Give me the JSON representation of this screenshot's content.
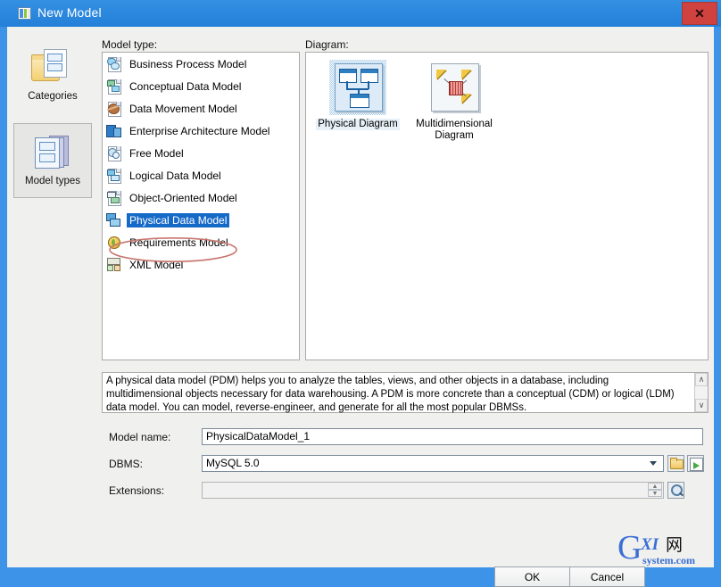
{
  "window": {
    "title": "New Model",
    "close_label": "✕",
    "title_icon": "document-icon"
  },
  "rail": {
    "items": [
      {
        "label": "Categories",
        "icon": "categories-icon",
        "selected": false
      },
      {
        "label": "Model types",
        "icon": "model-types-icon",
        "selected": true
      }
    ]
  },
  "model_type": {
    "label": "Model type:",
    "items": [
      {
        "label": "Business Process Model",
        "icon": "business-process-model-icon",
        "selected": false
      },
      {
        "label": "Conceptual Data Model",
        "icon": "conceptual-data-model-icon",
        "selected": false
      },
      {
        "label": "Data Movement Model",
        "icon": "data-movement-model-icon",
        "selected": false
      },
      {
        "label": "Enterprise Architecture Model",
        "icon": "enterprise-architecture-model-icon",
        "selected": false
      },
      {
        "label": "Free Model",
        "icon": "free-model-icon",
        "selected": false
      },
      {
        "label": "Logical Data Model",
        "icon": "logical-data-model-icon",
        "selected": false
      },
      {
        "label": "Object-Oriented Model",
        "icon": "object-oriented-model-icon",
        "selected": false
      },
      {
        "label": "Physical Data Model",
        "icon": "physical-data-model-icon",
        "selected": true
      },
      {
        "label": "Requirements Model",
        "icon": "requirements-model-icon",
        "selected": false
      },
      {
        "label": "XML Model",
        "icon": "xml-model-icon",
        "selected": false
      }
    ]
  },
  "diagram": {
    "label": "Diagram:",
    "view_icon": "grid-view-icon",
    "view_arrow_icon": "chevron-down-icon",
    "items": [
      {
        "label": "Physical Diagram",
        "icon": "physical-diagram-icon",
        "selected": true
      },
      {
        "label": "Multidimensional Diagram",
        "icon": "multidimensional-diagram-icon",
        "selected": false
      }
    ]
  },
  "description": {
    "text": "A physical data model (PDM) helps you to analyze the tables, views, and other objects in a database, including multidimensional objects necessary for data warehousing. A PDM is more concrete than a conceptual (CDM) or logical (LDM) data model. You can model, reverse-engineer, and generate for all the most popular DBMSs.",
    "scroll_up_icon": "∧",
    "scroll_down_icon": "∨"
  },
  "fields": {
    "model_name": {
      "label": "Model name:",
      "value": "PhysicalDataModel_1",
      "placeholder": ""
    },
    "dbms": {
      "label": "DBMS:",
      "value": "MySQL 5.0",
      "placeholder": "",
      "dropdown_icon": "chevron-down-icon",
      "folder_icon": "folder-open-icon",
      "import_icon": "import-arrow-icon"
    },
    "extensions": {
      "label": "Extensions:",
      "value": "",
      "placeholder": "",
      "spinner_up_icon": "▲",
      "spinner_down_icon": "▼",
      "browse_icon": "magnifier-icon"
    }
  },
  "buttons": {
    "ok": "OK",
    "cancel": "Cancel"
  },
  "annotation": {
    "shape": "red-ellipse-highlight",
    "color": "#c8766e"
  },
  "watermark": {
    "primary": "GXI",
    "cjk": "网",
    "secondary": "system.com",
    "color": "#3b6fd4"
  },
  "colors": {
    "titlebar": "#2b87dd",
    "selection": "#1569c7",
    "dialog_bg": "#f0f0ee",
    "close_button": "#cf4240"
  }
}
